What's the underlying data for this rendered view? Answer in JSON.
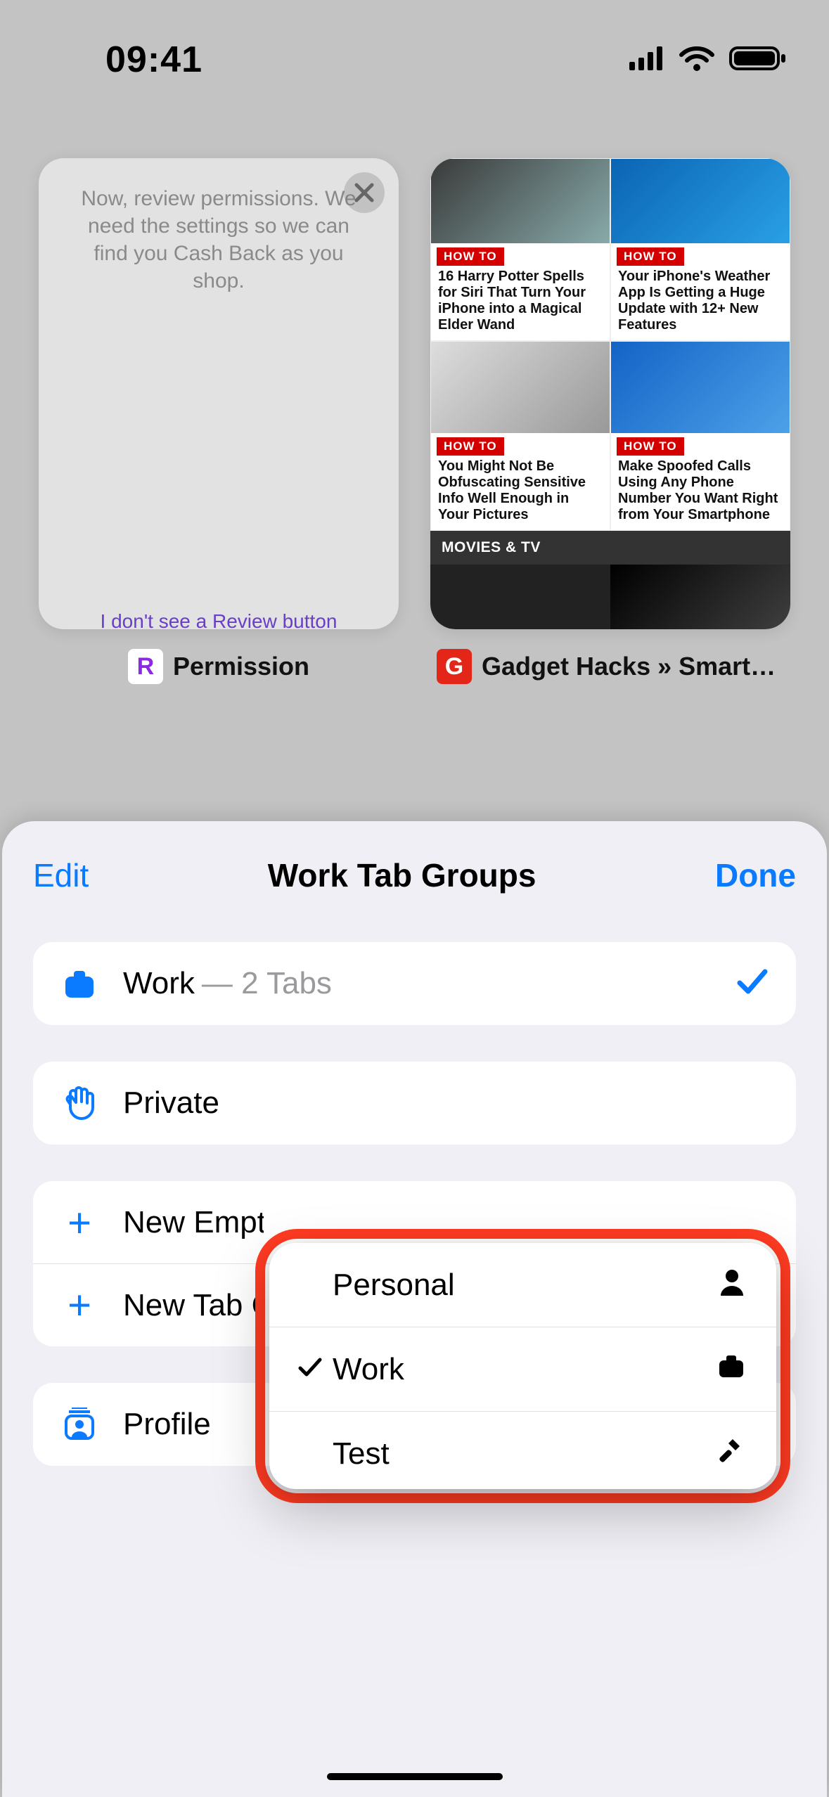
{
  "status": {
    "time": "09:41"
  },
  "tabs": [
    {
      "title": "Permission",
      "favicon_letter": "R",
      "body": "Now, review permissions. We need the settings so we can find you Cash Back as you shop.",
      "bottom_link": "I don't see a Review button"
    },
    {
      "title": "Gadget Hacks » Smartph…",
      "favicon_letter": "G",
      "articles": {
        "a1": {
          "tag": "HOW TO",
          "title": "16 Harry Potter Spells for Siri That Turn Your iPhone into a Magical Elder Wand"
        },
        "a2": {
          "tag": "HOW TO",
          "title": "Your iPhone's Weather App Is Getting a Huge Update with 12+ New Features"
        },
        "a3": {
          "tag": "HOW TO",
          "title": "You Might Not Be Obfuscating Sensitive Info Well Enough in Your Pictures"
        },
        "a4": {
          "tag": "HOW TO",
          "title": "Make Spoofed Calls Using Any Phone Number You Want Right from Your Smartphone"
        }
      },
      "section": "MOVIES & TV"
    }
  ],
  "sheet": {
    "edit": "Edit",
    "title": "Work Tab Groups",
    "done": "Done",
    "work_row": {
      "label": "Work",
      "meta": "— 2 Tabs"
    },
    "private_row": {
      "label": "Private"
    },
    "new_empty": "New Empty Tab Group",
    "new_tab": "New Tab Group from 2 Tabs",
    "profile_row": {
      "label": "Profile",
      "value": "Work"
    }
  },
  "popover": {
    "items": [
      {
        "label": "Personal",
        "checked": false,
        "icon": "person"
      },
      {
        "label": "Work",
        "checked": true,
        "icon": "briefcase"
      },
      {
        "label": "Test",
        "checked": false,
        "icon": "hammer"
      }
    ]
  }
}
